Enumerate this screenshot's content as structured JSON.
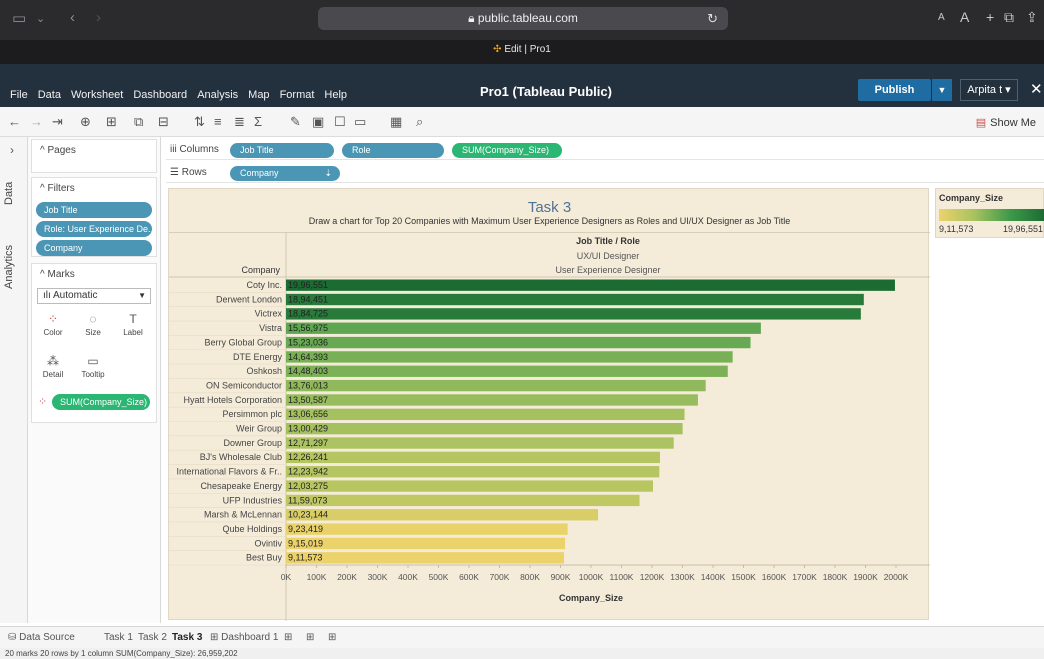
{
  "browser": {
    "url": "public.tableau.com",
    "tab_title": "Edit | Pro1"
  },
  "app": {
    "menu": [
      "File",
      "Data",
      "Worksheet",
      "Dashboard",
      "Analysis",
      "Map",
      "Format",
      "Help"
    ],
    "title": "Pro1 (Tableau Public)",
    "publish_label": "Publish",
    "user_label": "Arpita t ▾"
  },
  "toolbar": {
    "show_me_label": "Show Me"
  },
  "side_tabs": {
    "data": "Data",
    "analytics": "Analytics"
  },
  "pages_card": {
    "title": "Pages"
  },
  "filters_card": {
    "title": "Filters",
    "items": [
      "Job Title",
      "Role: User Experience De...",
      "Company"
    ]
  },
  "marks_card": {
    "title": "Marks",
    "type": "Automatic",
    "buttons": [
      "Color",
      "Size",
      "Label",
      "Detail",
      "Tooltip"
    ],
    "pill": "SUM(Company_Size)"
  },
  "shelves": {
    "columns_label": "Columns",
    "columns": [
      "Job Title",
      "Role",
      "SUM(Company_Size)"
    ],
    "rows_label": "Rows",
    "rows": [
      "Company"
    ]
  },
  "chart_data": {
    "type": "bar",
    "title": "Task 3",
    "subtitle": "Draw a chart for Top 20 Companies with Maximum User Experience Designers as Roles and UI/UX Designer as Job Title",
    "header_lines": [
      "Job Title / Role",
      "UX/UI Designer",
      "User Experience Designer"
    ],
    "row_header": "Company",
    "xlabel": "Company_Size",
    "xlim": [
      0,
      2000000
    ],
    "xticks": [
      "0K",
      "100K",
      "200K",
      "300K",
      "400K",
      "500K",
      "600K",
      "700K",
      "800K",
      "900K",
      "1000K",
      "1100K",
      "1200K",
      "1300K",
      "1400K",
      "1500K",
      "1600K",
      "1700K",
      "1800K",
      "1900K",
      "2000K"
    ],
    "categories": [
      "Coty Inc.",
      "Derwent London",
      "Victrex",
      "Vistra",
      "Berry Global Group",
      "DTE Energy",
      "Oshkosh",
      "ON Semiconductor",
      "Hyatt Hotels Corporation",
      "Persimmon plc",
      "Weir Group",
      "Downer Group",
      "BJ's Wholesale Club",
      "International Flavors & Fr..",
      "Chesapeake Energy",
      "UFP Industries",
      "Marsh & McLennan",
      "Qube Holdings",
      "Ovintiv",
      "Best Buy"
    ],
    "values": [
      1996551,
      1894451,
      1884725,
      1556975,
      1523036,
      1464393,
      1448403,
      1376013,
      1350587,
      1306656,
      1300429,
      1271297,
      1226241,
      1223942,
      1203275,
      1159073,
      1023144,
      923419,
      915019,
      911573
    ],
    "labels": [
      "19,96,551",
      "18,94,451",
      "18,84,725",
      "15,56,975",
      "15,23,036",
      "14,64,393",
      "14,48,403",
      "13,76,013",
      "13,50,587",
      "13,06,656",
      "13,00,429",
      "12,71,297",
      "12,26,241",
      "12,23,942",
      "12,03,275",
      "11,59,073",
      "10,23,144",
      "9,23,419",
      "9,15,019",
      "9,11,573"
    ],
    "color_scale": {
      "min_color": "#ecd26a",
      "max_color": "#1c6b33"
    }
  },
  "legend": {
    "title": "Company_Size",
    "min": "9,11,573",
    "max": "19,96,551"
  },
  "sheets": {
    "data_source": "Data Source",
    "tabs": [
      "Task 1",
      "Task 2",
      "Task 3",
      "Dashboard 1"
    ],
    "active": "Task 3"
  },
  "status_bar": "20 marks   20 rows by 1 column   SUM(Company_Size): 26,959,202"
}
